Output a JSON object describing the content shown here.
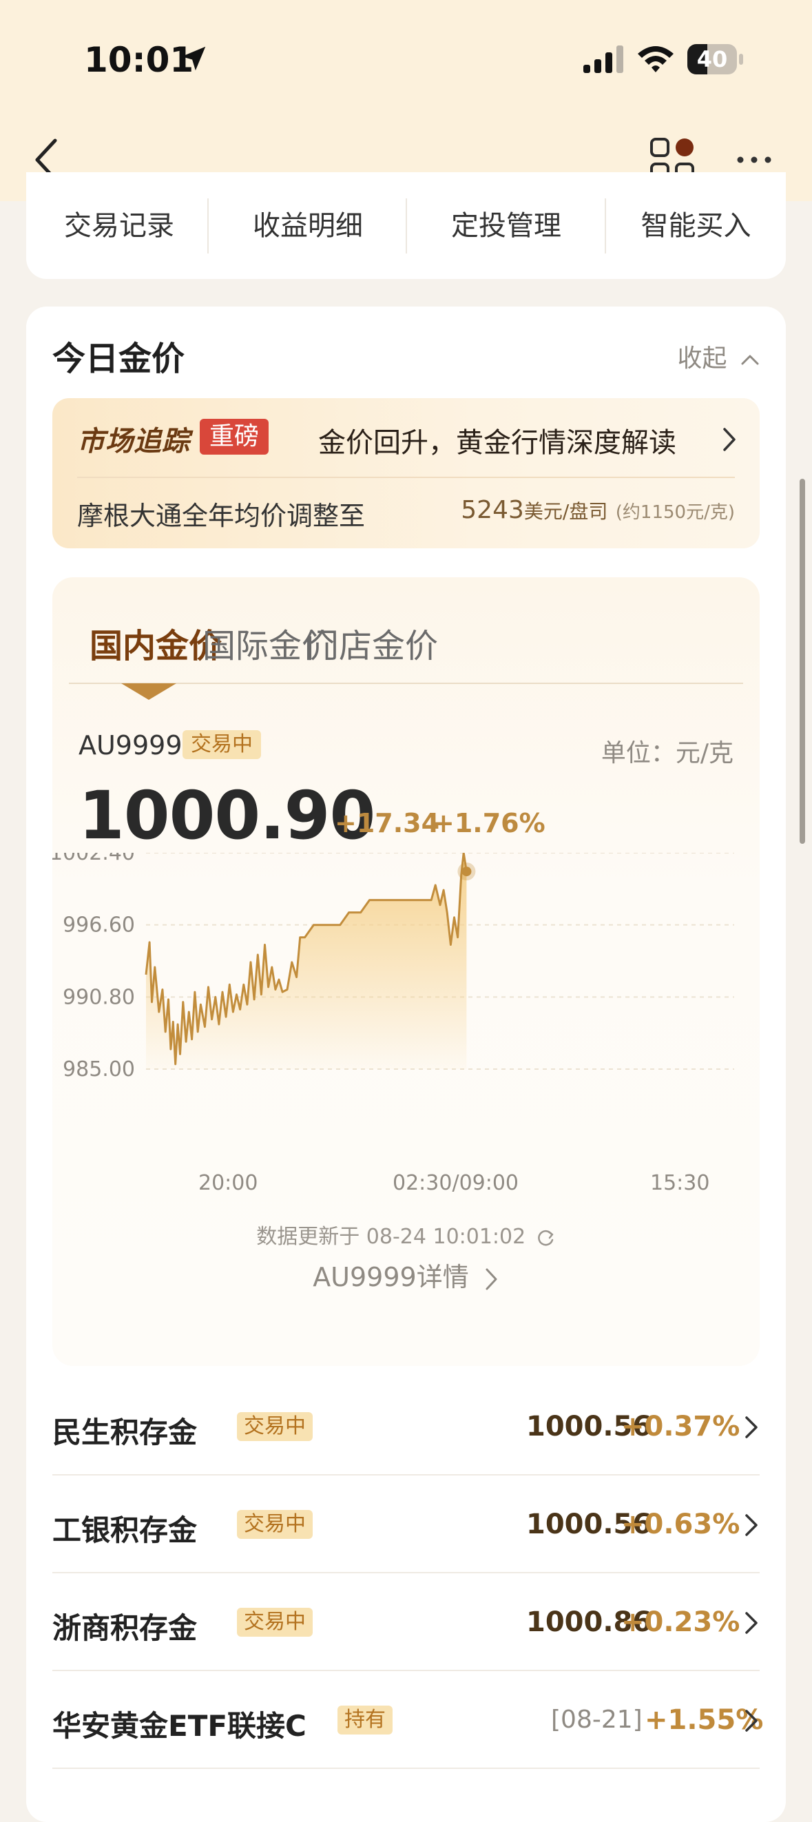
{
  "status_bar": {
    "time": "10:01",
    "battery": "40",
    "battery_level": 0.4
  },
  "quick_tabs": [
    "交易记录",
    "收益明细",
    "定投管理",
    "智能买入"
  ],
  "section": {
    "title": "今日金价",
    "collapse_label": "收起"
  },
  "news": {
    "brand": "市场追踪",
    "badge": "重磅",
    "headline": "金价回升，黄金行情深度解读",
    "sub_text": "摩根大通全年均价调整至",
    "value": "5243",
    "value_unit": "美元/盘司",
    "value_approx": "(约1150元/克)"
  },
  "price_tabs": [
    {
      "label": "国内金价",
      "active": true
    },
    {
      "label": "国际金价",
      "active": false
    },
    {
      "label": "门店金价",
      "active": false
    }
  ],
  "quote": {
    "symbol": "AU9999",
    "status": "交易中",
    "unit": "单位：元/克",
    "price": "1000.90",
    "change": "+17.34",
    "change_pct": "+1.76%"
  },
  "chart_data": {
    "type": "area",
    "y_ticks": [
      "1002.40",
      "996.60",
      "990.80",
      "985.00"
    ],
    "ylim": [
      985.0,
      1002.4
    ],
    "x_ticks": [
      "20:00",
      "02:30/09:00",
      "15:30"
    ],
    "x_start_label": "20:00",
    "x_end_label": "15:30",
    "line_color": "#c28d3c",
    "fill_color": "#f5d08a",
    "series": [
      {
        "t": 0.0,
        "v": 992.6
      },
      {
        "t": 0.006,
        "v": 995.2
      },
      {
        "t": 0.01,
        "v": 990.4
      },
      {
        "t": 0.015,
        "v": 993.2
      },
      {
        "t": 0.022,
        "v": 989.6
      },
      {
        "t": 0.028,
        "v": 991.4
      },
      {
        "t": 0.033,
        "v": 988.0
      },
      {
        "t": 0.038,
        "v": 990.6
      },
      {
        "t": 0.042,
        "v": 986.6
      },
      {
        "t": 0.046,
        "v": 988.8
      },
      {
        "t": 0.05,
        "v": 985.4
      },
      {
        "t": 0.054,
        "v": 988.6
      },
      {
        "t": 0.058,
        "v": 986.2
      },
      {
        "t": 0.063,
        "v": 990.4
      },
      {
        "t": 0.068,
        "v": 987.2
      },
      {
        "t": 0.073,
        "v": 989.6
      },
      {
        "t": 0.078,
        "v": 987.4
      },
      {
        "t": 0.083,
        "v": 991.2
      },
      {
        "t": 0.088,
        "v": 988.0
      },
      {
        "t": 0.093,
        "v": 990.2
      },
      {
        "t": 0.1,
        "v": 988.4
      },
      {
        "t": 0.106,
        "v": 991.6
      },
      {
        "t": 0.112,
        "v": 989.0
      },
      {
        "t": 0.118,
        "v": 990.8
      },
      {
        "t": 0.124,
        "v": 988.6
      },
      {
        "t": 0.13,
        "v": 991.2
      },
      {
        "t": 0.136,
        "v": 989.2
      },
      {
        "t": 0.142,
        "v": 991.8
      },
      {
        "t": 0.148,
        "v": 989.6
      },
      {
        "t": 0.154,
        "v": 991.0
      },
      {
        "t": 0.16,
        "v": 989.8
      },
      {
        "t": 0.166,
        "v": 991.8
      },
      {
        "t": 0.172,
        "v": 990.2
      },
      {
        "t": 0.178,
        "v": 993.6
      },
      {
        "t": 0.184,
        "v": 990.6
      },
      {
        "t": 0.19,
        "v": 994.2
      },
      {
        "t": 0.196,
        "v": 991.0
      },
      {
        "t": 0.202,
        "v": 995.0
      },
      {
        "t": 0.208,
        "v": 991.6
      },
      {
        "t": 0.214,
        "v": 993.2
      },
      {
        "t": 0.22,
        "v": 991.4
      },
      {
        "t": 0.226,
        "v": 992.2
      },
      {
        "t": 0.232,
        "v": 991.2
      },
      {
        "t": 0.24,
        "v": 991.4
      },
      {
        "t": 0.248,
        "v": 993.6
      },
      {
        "t": 0.256,
        "v": 992.4
      },
      {
        "t": 0.262,
        "v": 995.6
      },
      {
        "t": 0.27,
        "v": 995.6
      },
      {
        "t": 0.285,
        "v": 996.6
      },
      {
        "t": 0.33,
        "v": 996.6
      },
      {
        "t": 0.345,
        "v": 997.6
      },
      {
        "t": 0.365,
        "v": 997.6
      },
      {
        "t": 0.38,
        "v": 998.6
      },
      {
        "t": 0.485,
        "v": 998.6
      },
      {
        "t": 0.492,
        "v": 999.8
      },
      {
        "t": 0.5,
        "v": 998.2
      },
      {
        "t": 0.506,
        "v": 999.4
      },
      {
        "t": 0.512,
        "v": 997.6
      },
      {
        "t": 0.518,
        "v": 995.0
      },
      {
        "t": 0.524,
        "v": 997.2
      },
      {
        "t": 0.53,
        "v": 995.6
      },
      {
        "t": 0.536,
        "v": 1000.6
      },
      {
        "t": 0.54,
        "v": 1002.4
      },
      {
        "t": 0.545,
        "v": 1000.9
      }
    ]
  },
  "update_text": "数据更新于 08-24 10:01:02",
  "detail_link": "AU9999详情",
  "products": [
    {
      "name": "民生积存金",
      "badge": "交易中",
      "price": "1000.56",
      "change": "+0.37%"
    },
    {
      "name": "工银积存金",
      "badge": "交易中",
      "price": "1000.56",
      "change": "+0.63%"
    },
    {
      "name": "浙商积存金",
      "badge": "交易中",
      "price": "1000.86",
      "change": "+0.23%"
    },
    {
      "name": "华安黄金ETF联接C",
      "badge": "持有",
      "date": "[08-21]",
      "change": "+1.55%"
    }
  ]
}
